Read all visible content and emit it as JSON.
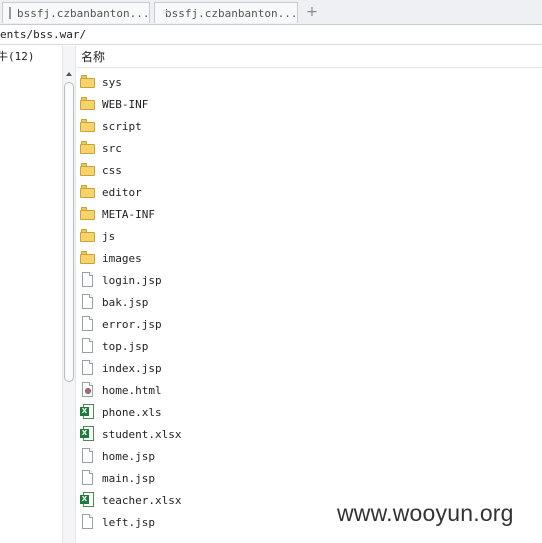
{
  "tabs": [
    {
      "label": "bssfj.czbanbanton...",
      "icon": "document-icon"
    },
    {
      "label": "bssfj.czbanbanton...",
      "icon": "terminal-icon"
    }
  ],
  "new_tab_label": "+",
  "path": "ents/bss.war/",
  "left_header": "牛(12)",
  "column_header": "名称",
  "files": [
    {
      "name": "sys",
      "type": "folder"
    },
    {
      "name": "WEB-INF",
      "type": "folder"
    },
    {
      "name": "script",
      "type": "folder"
    },
    {
      "name": "src",
      "type": "folder"
    },
    {
      "name": "css",
      "type": "folder"
    },
    {
      "name": "editor",
      "type": "folder"
    },
    {
      "name": "META-INF",
      "type": "folder"
    },
    {
      "name": "js",
      "type": "folder"
    },
    {
      "name": "images",
      "type": "folder"
    },
    {
      "name": "login.jsp",
      "type": "file"
    },
    {
      "name": "bak.jsp",
      "type": "file"
    },
    {
      "name": "error.jsp",
      "type": "file"
    },
    {
      "name": "top.jsp",
      "type": "file"
    },
    {
      "name": "index.jsp",
      "type": "file"
    },
    {
      "name": "home.html",
      "type": "html"
    },
    {
      "name": "phone.xls",
      "type": "xls"
    },
    {
      "name": "student.xlsx",
      "type": "xls"
    },
    {
      "name": "home.jsp",
      "type": "file"
    },
    {
      "name": "main.jsp",
      "type": "file"
    },
    {
      "name": "teacher.xlsx",
      "type": "xls"
    },
    {
      "name": "left.jsp",
      "type": "file"
    }
  ],
  "watermark": "www.wooyun.org"
}
